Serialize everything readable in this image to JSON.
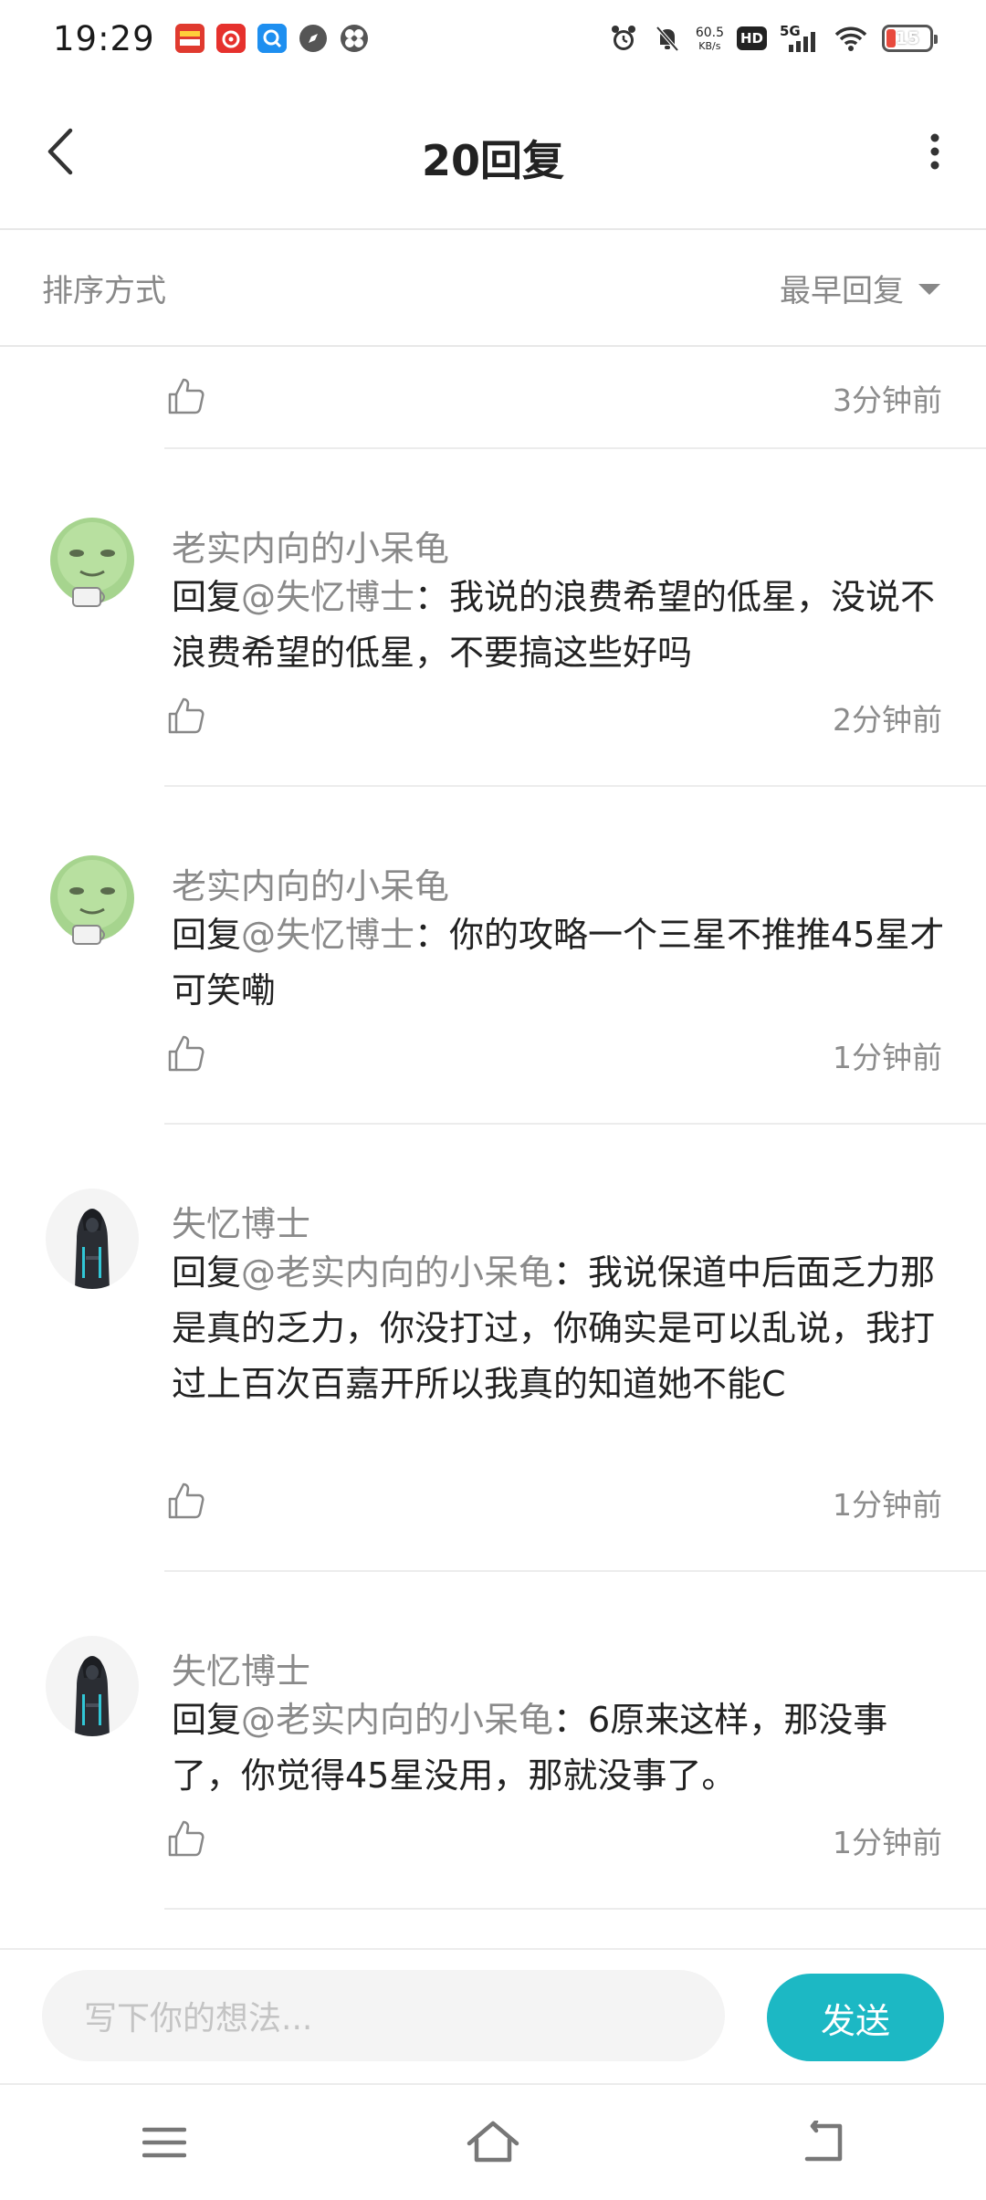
{
  "status_bar": {
    "time": "19:29",
    "net_speed_value": "60.5",
    "net_speed_unit": "KB/s",
    "hd_label": "HD",
    "network_label": "5G",
    "battery_level": "15",
    "battery_color": "#e84a3d"
  },
  "header": {
    "title": "20回复"
  },
  "sort": {
    "label": "排序方式",
    "selected": "最早回复"
  },
  "top_item": {
    "time": "3分钟前"
  },
  "comments": [
    {
      "name": "老实内向的小呆龟",
      "prefix": "回复",
      "mention": "@失忆博士",
      "text": "：我说的浪费希望的低星，没说不浪费希望的低星，不要搞这些好吗",
      "time": "2分钟前",
      "avatar": "green-meme-avatar"
    },
    {
      "name": "老实内向的小呆龟",
      "prefix": "回复",
      "mention": "@失忆博士",
      "text": "：你的攻略一个三星不推推45星才可笑嘞",
      "time": "1分钟前",
      "avatar": "green-meme-avatar"
    },
    {
      "name": "失忆博士",
      "prefix": "回复",
      "mention": "@老实内向的小呆龟",
      "text": "：我说保道中后面乏力那是真的乏力，你没打过，你确实是可以乱说，我打过上百次百嘉开所以我真的知道她不能C",
      "time": "1分钟前",
      "avatar": "dark-character-avatar"
    },
    {
      "name": "失忆博士",
      "prefix": "回复",
      "mention": "@老实内向的小呆龟",
      "text": "：6原来这样，那没事了，你觉得45星没用，那就没事了。",
      "time": "1分钟前",
      "avatar": "dark-character-avatar"
    }
  ],
  "input": {
    "placeholder": "写下你的想法...",
    "send_label": "发送",
    "accent_color": "#1cb8c4"
  },
  "nav": {
    "icons": [
      "menu-icon",
      "home-icon",
      "back-nav-icon"
    ]
  }
}
